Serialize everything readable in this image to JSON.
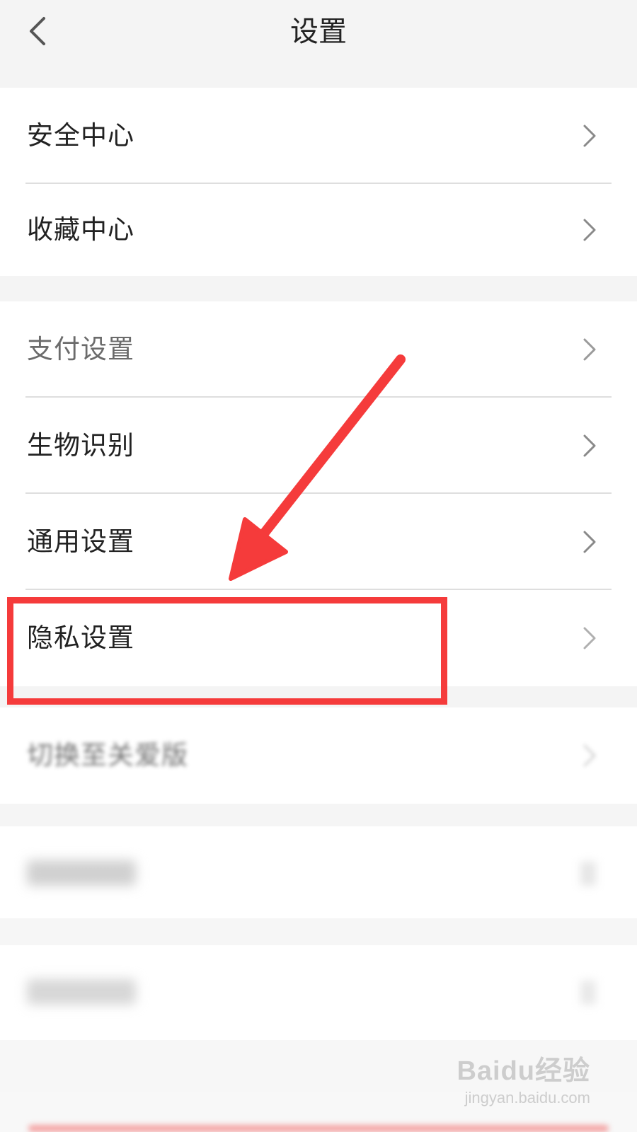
{
  "header": {
    "title": "设置",
    "back_icon": "chevron-left-icon"
  },
  "group1": [
    {
      "label": "安全中心",
      "icon": "chevron-right-icon"
    },
    {
      "label": "收藏中心",
      "icon": "chevron-right-icon"
    }
  ],
  "group2": [
    {
      "label": "支付设置",
      "icon": "chevron-right-icon"
    },
    {
      "label": "生物识别",
      "icon": "chevron-right-icon"
    },
    {
      "label": "通用设置",
      "icon": "chevron-right-icon"
    },
    {
      "label": "隐私设置",
      "icon": "chevron-right-icon"
    },
    {
      "label": "切换至关爱版",
      "icon": "chevron-right-icon"
    }
  ],
  "annotation": {
    "color": "#f53b3b"
  },
  "watermark": {
    "brand": "Baidu经验",
    "url": "jingyan.baidu.com"
  }
}
